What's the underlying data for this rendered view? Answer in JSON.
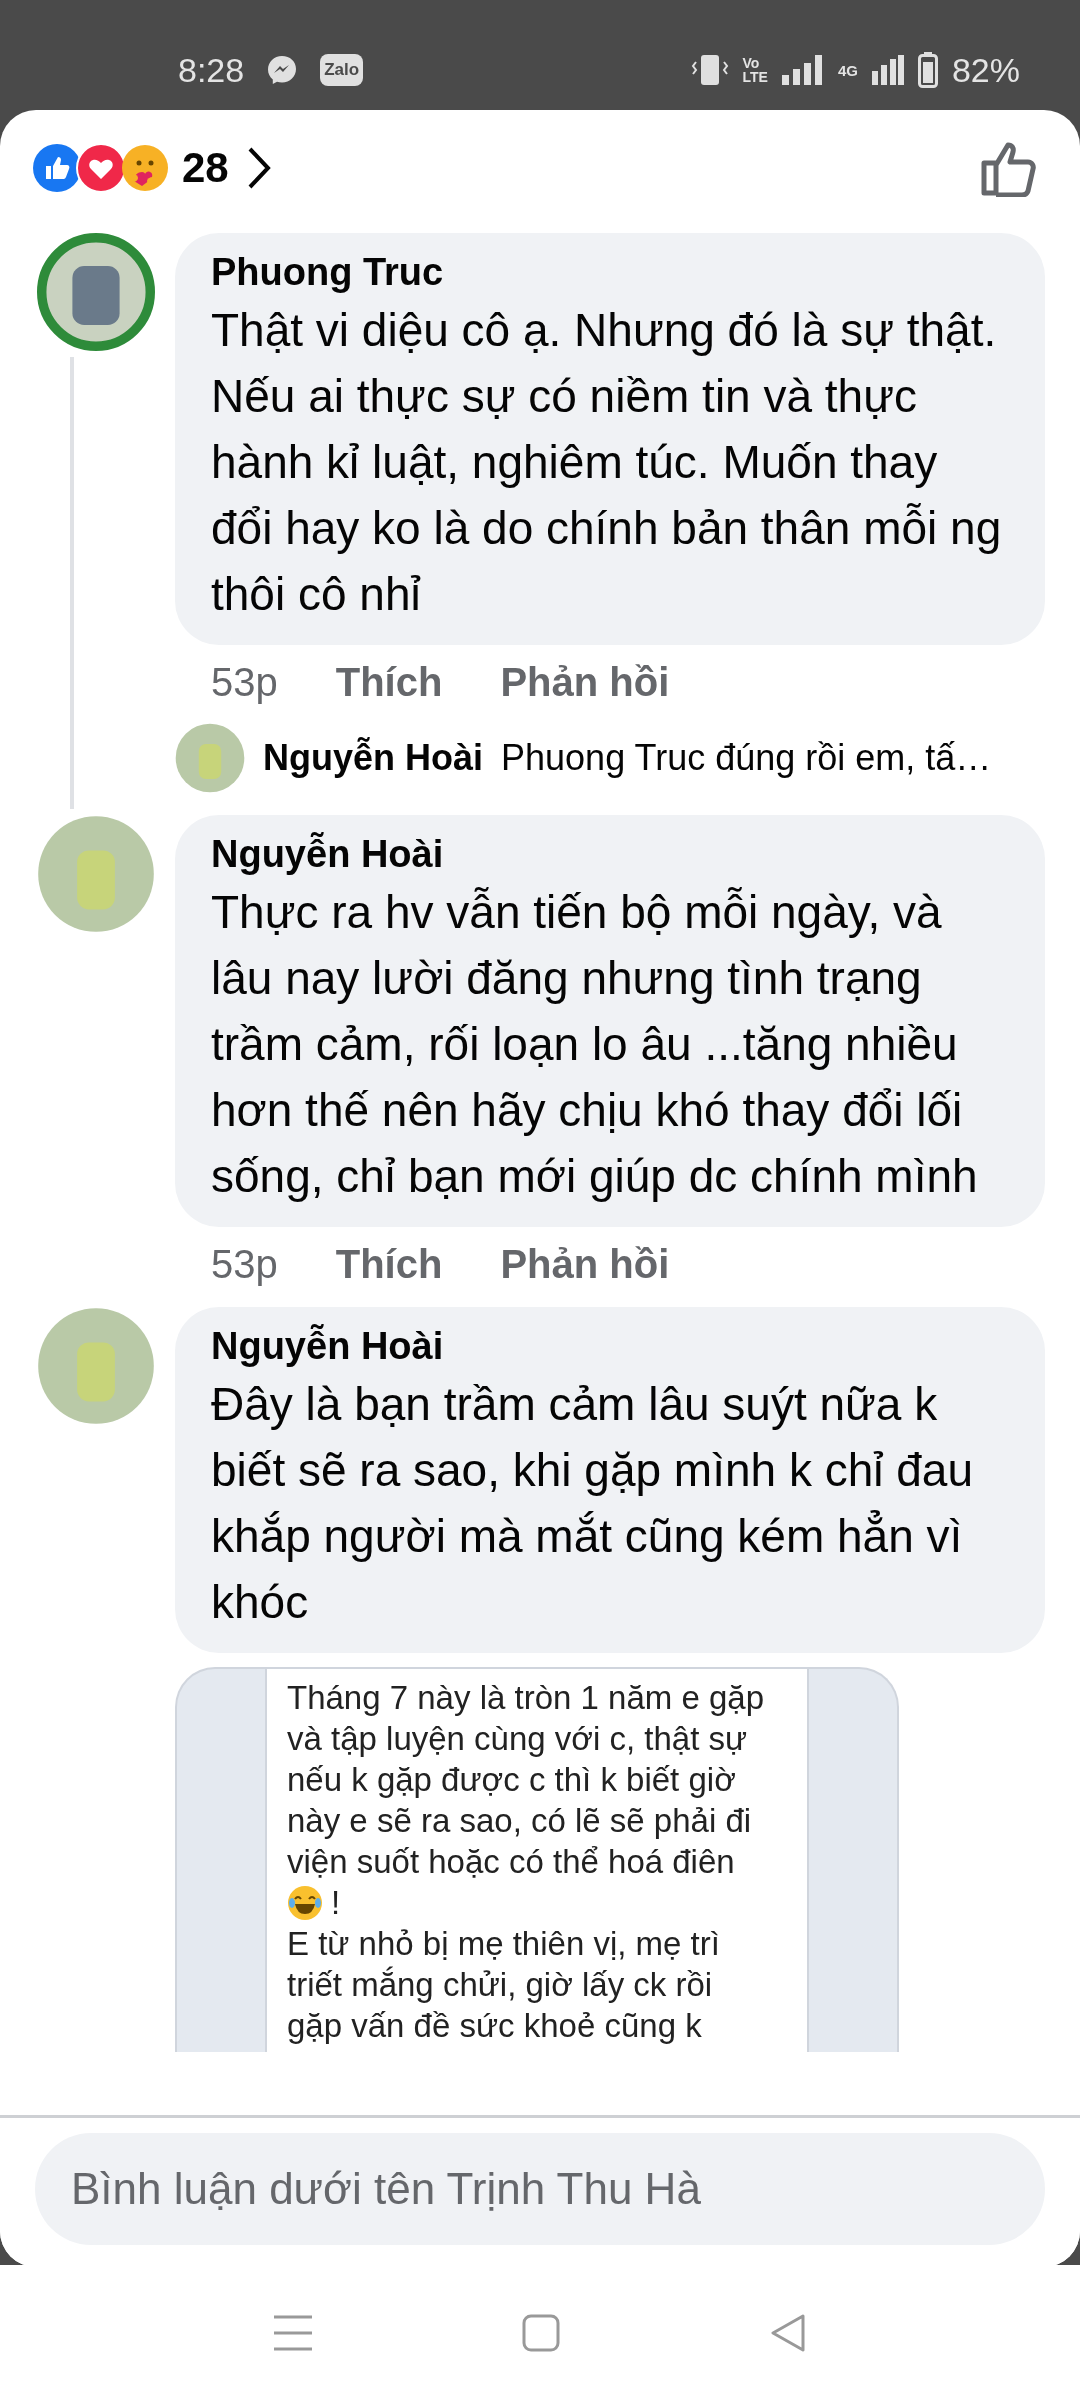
{
  "status_bar": {
    "time": "8:28",
    "zalo_label": "Zalo",
    "volte_lines": [
      "Vo",
      "LTE"
    ],
    "network": "4G",
    "battery": "82%"
  },
  "reactions": {
    "count": "28"
  },
  "comments": [
    {
      "author": "Phuong Truc",
      "kind": "ring",
      "text": "Thật vi diệu cô ạ. Nhưng đó là sự thật. Nếu ai thực sự có niềm tin và thực hành kỉ luật, nghiêm túc. Muốn thay đổi hay ko là do chính bản thân mỗi ng thôi cô nhỉ",
      "time": "53p",
      "like": "Thích",
      "reply": "Phản hồi",
      "replies": [
        {
          "author": "Nguyễn Hoài",
          "text": "Phuong Truc đúng rồi em, tấ…"
        }
      ]
    },
    {
      "author": "Nguyễn Hoài",
      "kind": "plain",
      "text": "Thực ra hv vẫn tiến bộ mỗi ngày, và lâu nay lười đăng nhưng tình trạng trầm cảm, rối loạn lo âu ...tăng nhiều hơn thế nên hãy chịu khó thay đổi lối sống, chỉ bạn mới giúp dc chính mình",
      "time": "53p",
      "like": "Thích",
      "reply": "Phản hồi"
    },
    {
      "author": "Nguyễn Hoài",
      "kind": "plain",
      "text": "Đây là bạn trầm cảm lâu suýt nữa k biết sẽ ra sao, khi gặp mình k chỉ đau khắp người mà mắt cũng kém hẳn vì khóc",
      "attachment": {
        "lines": [
          {
            "text": "Tháng 7 này là tròn 1 năm e gặp",
            "emoji": false
          },
          {
            "text": "và tập luyện cùng với c, thật sự",
            "emoji": false
          },
          {
            "text": "nếu k gặp được c thì k biết giờ",
            "emoji": false
          },
          {
            "text": "này e sẽ ra sao, có lẽ sẽ phải đi",
            "emoji": false
          },
          {
            "text": "viện suốt hoặc có thể hoá điên",
            "emoji": false
          },
          {
            "text": "!",
            "emoji": true
          },
          {
            "text": "E từ nhỏ bị mẹ thiên vị, mẹ trì",
            "emoji": false
          },
          {
            "text": "triết mắng chửi, giờ lấy ck rồi",
            "emoji": false
          },
          {
            "text": "gặp vấn đề sức khoẻ cũng k",
            "emoji": false
          }
        ]
      }
    }
  ],
  "composer": {
    "placeholder": "Bình luận dưới tên Trịnh Thu Hà"
  }
}
